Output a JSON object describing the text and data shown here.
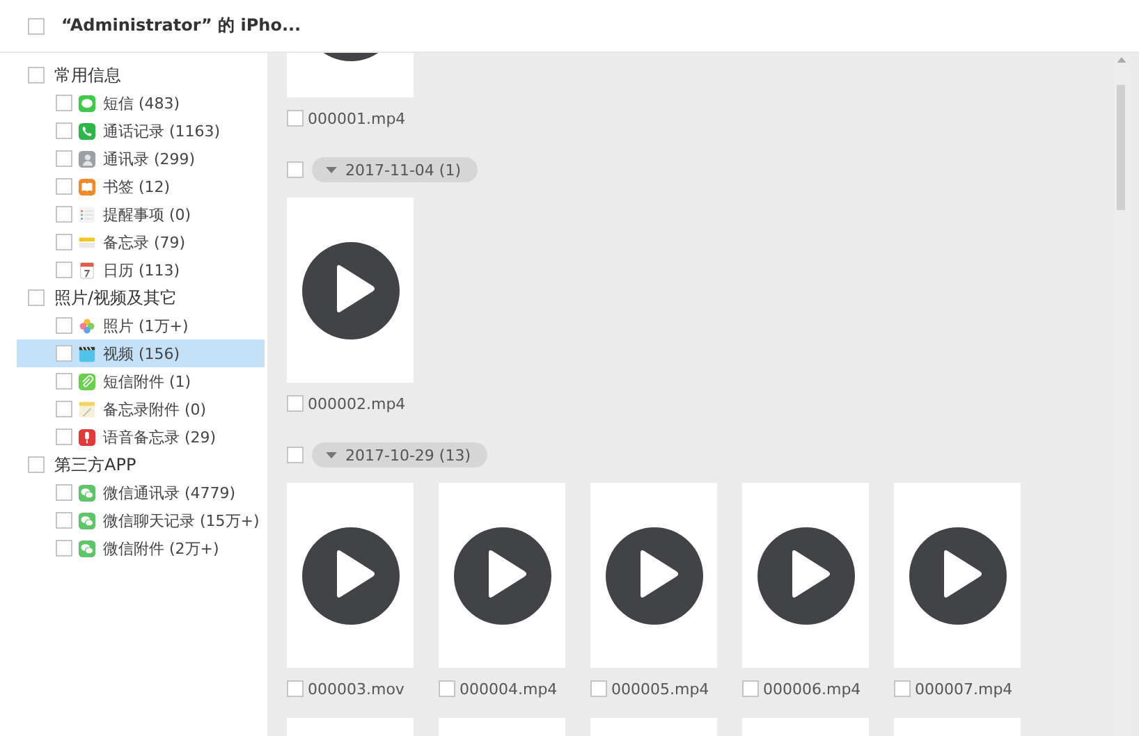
{
  "header": {
    "title": "“Administrator” 的 iPho...",
    "checked": false
  },
  "sidebar": {
    "categories": [
      {
        "label": "常用信息",
        "checked": false,
        "children": [
          {
            "label": "短信 (483)",
            "kind": "message",
            "checked": false,
            "selected": false
          },
          {
            "label": "通话记录 (1163)",
            "kind": "phone",
            "checked": false,
            "selected": false
          },
          {
            "label": "通讯录 (299)",
            "kind": "contacts",
            "checked": false,
            "selected": false
          },
          {
            "label": "书签 (12)",
            "kind": "book",
            "checked": false,
            "selected": false
          },
          {
            "label": "提醒事项 (0)",
            "kind": "list",
            "checked": false,
            "selected": false
          },
          {
            "label": "备忘录 (79)",
            "kind": "notes",
            "checked": false,
            "selected": false
          },
          {
            "label": "日历 (113)",
            "kind": "calendar",
            "checked": false,
            "selected": false
          }
        ]
      },
      {
        "label": "照片/视频及其它",
        "checked": false,
        "children": [
          {
            "label": "照片 (1万+)",
            "kind": "photos",
            "checked": false,
            "selected": false
          },
          {
            "label": "视频 (156)",
            "kind": "video",
            "checked": false,
            "selected": true
          },
          {
            "label": "短信附件 (1)",
            "kind": "clip",
            "checked": false,
            "selected": false
          },
          {
            "label": "备忘录附件 (0)",
            "kind": "notepad",
            "checked": false,
            "selected": false
          },
          {
            "label": "语音备忘录 (29)",
            "kind": "mic",
            "checked": false,
            "selected": false
          }
        ]
      },
      {
        "label": "第三方APP",
        "checked": false,
        "children": [
          {
            "label": "微信通讯录 (4779)",
            "kind": "chat",
            "checked": false,
            "selected": false
          },
          {
            "label": "微信聊天记录 (15万+)",
            "kind": "chat",
            "checked": false,
            "selected": false
          },
          {
            "label": "微信附件 (2万+)",
            "kind": "chat",
            "checked": false,
            "selected": false
          }
        ]
      }
    ]
  },
  "groups": [
    {
      "items": [
        {
          "kind": "cut_top",
          "name": "000001.mp4",
          "checked": false
        }
      ]
    },
    {
      "date": "2017-11-04 (1)",
      "checked": false,
      "items": [
        {
          "kind": "full",
          "name": "000002.mp4",
          "checked": false
        }
      ]
    },
    {
      "date": "2017-10-29 (13)",
      "checked": false,
      "items": [
        {
          "kind": "full",
          "name": "000003.mov",
          "checked": false
        },
        {
          "kind": "full",
          "name": "000004.mp4",
          "checked": false
        },
        {
          "kind": "full",
          "name": "000005.mp4",
          "checked": false
        },
        {
          "kind": "full",
          "name": "000006.mp4",
          "checked": false
        },
        {
          "kind": "full",
          "name": "000007.mp4",
          "checked": false
        },
        {
          "kind": "cut_bottom"
        },
        {
          "kind": "cut_bottom"
        },
        {
          "kind": "cut_bottom"
        },
        {
          "kind": "cut_bottom"
        },
        {
          "kind": "cut_bottom"
        }
      ]
    }
  ]
}
